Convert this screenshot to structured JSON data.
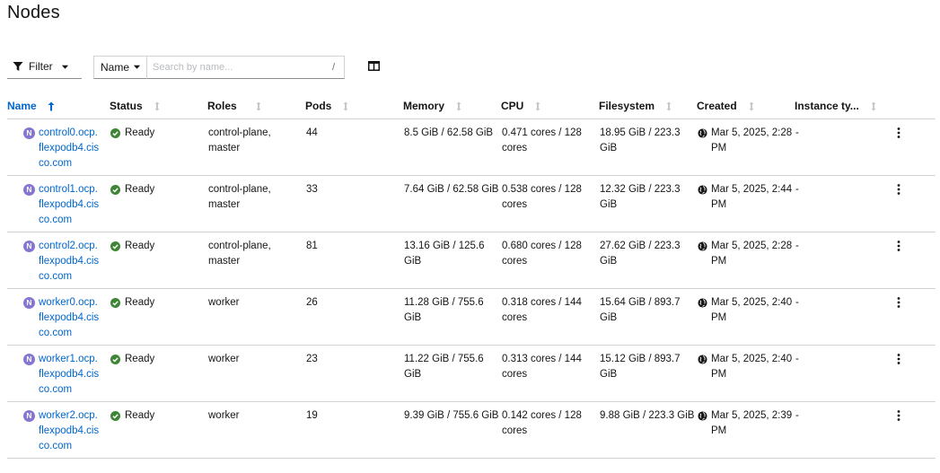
{
  "page": {
    "title": "Nodes"
  },
  "toolbar": {
    "filter_label": "Filter",
    "name_select": "Name",
    "search_placeholder": "Search by name...",
    "search_value": "",
    "search_shortcut": "/",
    "columns_icon": "columns-icon"
  },
  "columns": {
    "name": "Name",
    "status": "Status",
    "roles": "Roles",
    "pods": "Pods",
    "memory": "Memory",
    "cpu": "CPU",
    "filesystem": "Filesystem",
    "created": "Created",
    "instance_type": "Instance ty..."
  },
  "rows": [
    {
      "name": "control0.ocp.flexpodb4.cisco.com",
      "status": "Ready",
      "roles": "control-plane, master",
      "pods": "44",
      "memory": "8.5 GiB / 62.58 GiB",
      "cpu": "0.471 cores / 128 cores",
      "filesystem": "18.95 GiB / 223.3 GiB",
      "created": "Mar 5, 2025, 2:28 PM",
      "instance_type": "-"
    },
    {
      "name": "control1.ocp.flexpodb4.cisco.com",
      "status": "Ready",
      "roles": "control-plane, master",
      "pods": "33",
      "memory": "7.64 GiB / 62.58 GiB",
      "cpu": "0.538 cores / 128 cores",
      "filesystem": "12.32 GiB / 223.3 GiB",
      "created": "Mar 5, 2025, 2:44 PM",
      "instance_type": "-"
    },
    {
      "name": "control2.ocp.flexpodb4.cisco.com",
      "status": "Ready",
      "roles": "control-plane, master",
      "pods": "81",
      "memory": "13.16 GiB / 125.6 GiB",
      "cpu": "0.680 cores / 128 cores",
      "filesystem": "27.62 GiB / 223.3 GiB",
      "created": "Mar 5, 2025, 2:28 PM",
      "instance_type": "-"
    },
    {
      "name": "worker0.ocp.flexpodb4.cisco.com",
      "status": "Ready",
      "roles": "worker",
      "pods": "26",
      "memory": "11.28 GiB / 755.6 GiB",
      "cpu": "0.318 cores / 144 cores",
      "filesystem": "15.64 GiB / 893.7 GiB",
      "created": "Mar 5, 2025, 2:40 PM",
      "instance_type": "-"
    },
    {
      "name": "worker1.ocp.flexpodb4.cisco.com",
      "status": "Ready",
      "roles": "worker",
      "pods": "23",
      "memory": "11.22 GiB / 755.6 GiB",
      "cpu": "0.313 cores / 144 cores",
      "filesystem": "15.12 GiB / 893.7 GiB",
      "created": "Mar 5, 2025, 2:40 PM",
      "instance_type": "-"
    },
    {
      "name": "worker2.ocp.flexpodb4.cisco.com",
      "status": "Ready",
      "roles": "worker",
      "pods": "19",
      "memory": "9.39 GiB / 755.6 GiB",
      "cpu": "0.142 cores / 128 cores",
      "filesystem": "9.88 GiB / 223.3 GiB",
      "created": "Mar 5, 2025, 2:39 PM",
      "instance_type": "-"
    }
  ],
  "node_badge": "N",
  "colors": {
    "link": "#0066cc",
    "ready": "#3e8635",
    "badge": "#8476d1",
    "border": "#d2d2d2"
  }
}
